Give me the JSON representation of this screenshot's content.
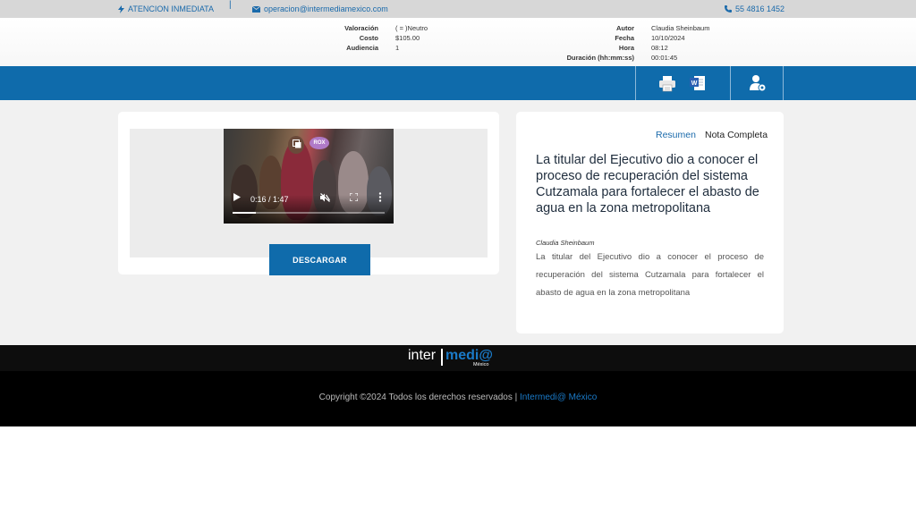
{
  "topbar": {
    "attention_label": "ATENCION INMEDIATA",
    "separator": "|",
    "email": "operacion@intermediamexico.com",
    "phone": "55 4816 1452"
  },
  "meta": {
    "left": [
      {
        "key": "Valoración",
        "value": "( = )Neutro"
      },
      {
        "key": "Costo",
        "value": "$105.00"
      },
      {
        "key": "Audiencia",
        "value": "1"
      }
    ],
    "right": [
      {
        "key": "Autor",
        "value": "Claudia Sheinbaum"
      },
      {
        "key": "Fecha",
        "value": "10/10/2024"
      },
      {
        "key": "Hora",
        "value": "08:12"
      },
      {
        "key": "Duración (hh:mm:ss)",
        "value": "00:01:45"
      }
    ]
  },
  "toolbar": {
    "icons": [
      "printer-icon",
      "word-document-icon",
      "user-settings-icon"
    ]
  },
  "video": {
    "time_display": "0:16 / 1:47",
    "progress": 0.15,
    "badge": "ROX",
    "download_label": "DESCARGAR"
  },
  "article": {
    "tabs": [
      "Resumen",
      "Nota Completa"
    ],
    "active_tab": 0,
    "title": "La titular del Ejecutivo dio a conocer el proceso de recuperación del sistema Cutzamala para fortalecer el abasto de agua en la zona metropolitana",
    "author": "Claudia Sheinbaum",
    "summary": "La titular del Ejecutivo dio a conocer el proceso de recuperación del sistema Cutzamala para fortalecer el abasto de agua en la zona metropolitana"
  },
  "footer": {
    "logo_left": "inter",
    "logo_right": "medi@",
    "logo_sub": "México",
    "copyright": "Copyright ©2024 Todos los derechos reservados |",
    "brand_link": "Intermedi@ México"
  },
  "colors": {
    "brand_blue": "#0f6bab",
    "link_blue": "#1a6aab",
    "footer_black": "#000000"
  }
}
